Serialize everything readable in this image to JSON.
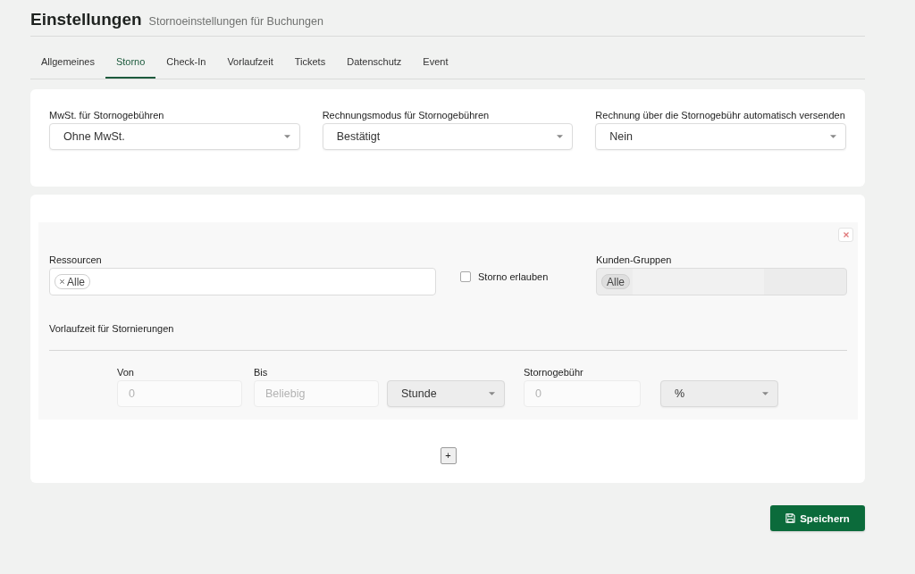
{
  "header": {
    "title": "Einstellungen",
    "subtitle": "Stornoeinstellungen für Buchungen"
  },
  "tabs": [
    {
      "label": "Allgemeines",
      "selected": false
    },
    {
      "label": "Storno",
      "selected": true
    },
    {
      "label": "Check-In",
      "selected": false
    },
    {
      "label": "Vorlaufzeit",
      "selected": false
    },
    {
      "label": "Tickets",
      "selected": false
    },
    {
      "label": "Datenschutz",
      "selected": false
    },
    {
      "label": "Event",
      "selected": false
    }
  ],
  "general_settings": [
    {
      "label": "MwSt. für Stornogebühren",
      "value": "Ohne MwSt."
    },
    {
      "label": "Rechnungsmodus für Stornogebühren",
      "value": "Bestätigt"
    },
    {
      "label": "Rechnung über die Stornogebühr automatisch versenden",
      "value": "Nein"
    }
  ],
  "rule": {
    "resources": {
      "label": "Ressourcen",
      "tags": [
        "Alle"
      ],
      "disabled": false
    },
    "allow_cancellation": {
      "label": "Storno erlauben",
      "checked": false
    },
    "customer_groups": {
      "label": "Kunden-Gruppen",
      "tags": [
        "Alle"
      ],
      "disabled": true
    },
    "lead_time": {
      "title": "Vorlaufzeit für Stornierungen",
      "fields": [
        {
          "kind": "input",
          "label": "Von",
          "placeholder": "0",
          "disabled": true
        },
        {
          "kind": "input",
          "label": "Bis",
          "placeholder": "Beliebig",
          "disabled": true
        },
        {
          "kind": "select",
          "value": "Stunde",
          "disabled": true
        },
        {
          "kind": "input",
          "label": "Stornogebühr",
          "placeholder": "0",
          "disabled": true
        },
        {
          "kind": "select",
          "value": "%",
          "disabled": true
        }
      ]
    }
  },
  "add_button": {
    "label": "+"
  },
  "save_button": {
    "label": "Speichern"
  }
}
